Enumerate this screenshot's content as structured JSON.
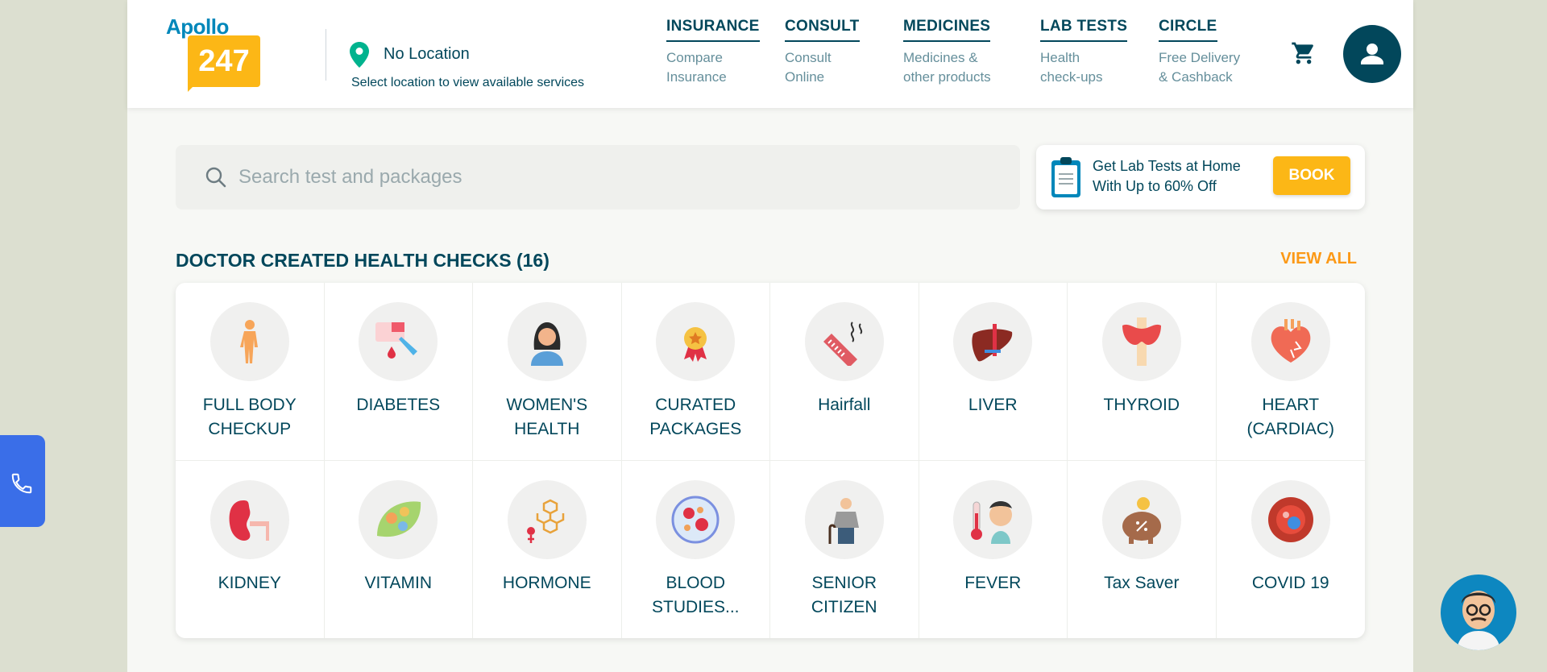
{
  "brand": {
    "word": "Apollo",
    "number": "247"
  },
  "location": {
    "name": "No Location",
    "subtitle": "Select location to view available services"
  },
  "nav": [
    {
      "title": "INSURANCE",
      "sub": "Compare\nInsurance"
    },
    {
      "title": "CONSULT",
      "sub": "Consult\nOnline"
    },
    {
      "title": "MEDICINES",
      "sub": "Medicines &\nother products"
    },
    {
      "title": "LAB TESTS",
      "sub": "Health\ncheck-ups"
    },
    {
      "title": "CIRCLE",
      "sub": "Free Delivery\n& Cashback"
    }
  ],
  "search": {
    "placeholder": "Search test and packages"
  },
  "promo": {
    "line1": "Get Lab Tests at Home",
    "line2": "With Up to 60% Off",
    "button": "BOOK"
  },
  "section": {
    "title": "DOCTOR CREATED HEALTH CHECKS (16)",
    "view_all": "VIEW ALL"
  },
  "checks": [
    {
      "label": "FULL BODY\nCHECKUP",
      "icon": "body-icon"
    },
    {
      "label": "DIABETES",
      "icon": "blood-drop-icon"
    },
    {
      "label": "WOMEN'S\nHEALTH",
      "icon": "woman-icon"
    },
    {
      "label": "CURATED\nPACKAGES",
      "icon": "medal-icon"
    },
    {
      "label": "Hairfall",
      "icon": "comb-icon"
    },
    {
      "label": "LIVER",
      "icon": "liver-icon"
    },
    {
      "label": "THYROID",
      "icon": "thyroid-icon"
    },
    {
      "label": "HEART\n(CARDIAC)",
      "icon": "heart-icon"
    },
    {
      "label": "KIDNEY",
      "icon": "kidney-icon"
    },
    {
      "label": "VITAMIN",
      "icon": "vitamin-icon"
    },
    {
      "label": "HORMONE",
      "icon": "hormone-icon"
    },
    {
      "label": "BLOOD\nSTUDIES...",
      "icon": "blood-cells-icon"
    },
    {
      "label": "SENIOR\nCITIZEN",
      "icon": "senior-icon"
    },
    {
      "label": "FEVER",
      "icon": "thermometer-icon"
    },
    {
      "label": "Tax Saver",
      "icon": "piggy-bank-icon"
    },
    {
      "label": "COVID 19",
      "icon": "virus-icon"
    }
  ],
  "colors": {
    "primary": "#02475b",
    "accent": "#fcb716",
    "link": "#fc9916",
    "call": "#3a6ee8"
  }
}
